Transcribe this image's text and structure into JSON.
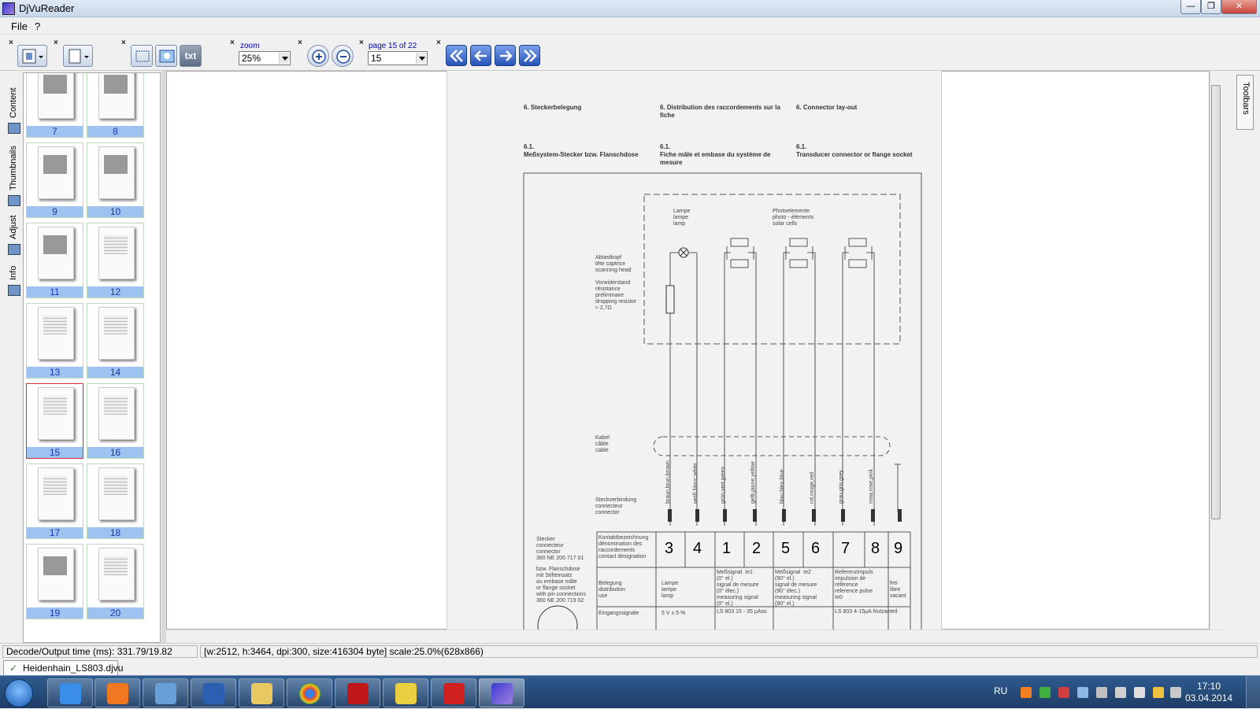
{
  "window": {
    "title": "DjVuReader",
    "min": "—",
    "max": "❐",
    "close": "✕"
  },
  "menu": [
    "File",
    "?"
  ],
  "toolbar": {
    "zoom_label": "zoom",
    "zoom_value": "25%",
    "page_label": "page 15 of 22",
    "page_value": "15",
    "txt_label": "txt"
  },
  "sidebar": {
    "tabs": [
      "Content",
      "Thumbnails",
      "Adjust",
      "Info"
    ],
    "thumbnails": [
      "7",
      "8",
      "9",
      "10",
      "11",
      "12",
      "13",
      "14",
      "15",
      "16",
      "17",
      "18",
      "19",
      "20"
    ],
    "selected": "15"
  },
  "document": {
    "heading_de": "6.  Steckerbelegung",
    "heading_fr": "6.  Distribution des raccordements sur la fiche",
    "heading_en": "6.  Connector lay-out",
    "sub_de_num": "6.1.",
    "sub_de": "Meßsystem-Stecker bzw. Flanschdose",
    "sub_fr_num": "6.1.",
    "sub_fr": "Fiche mâle et embase du système de mesure",
    "sub_en_num": "6.1.",
    "sub_en": "Transducer connector or flange socket",
    "lamp": "Lampe\nlampe\nlamp",
    "photo": "Photoelemente\nphoto - éléments\nsolar cells",
    "scanning": "Abtastkopf\ntête captrice\nscanning head",
    "resistor": "Vorwiderstand\nrésistance\npréliminaire\ndropping resistor\n≈ 2,7Ω",
    "cable": "Kabel\ncâble\ncable",
    "connector": "Steckverbindung\nconnecteur\nconnector",
    "plug": "Stecker\nconnecteur\nconnector\n360 NE 200 717 01",
    "flange": "bzw. Flanschdose\nmit Stifteinsatz\nou embase mâle\nor flange socket\nwith pin connections\n360 NE 200 719 02",
    "contact_header": "Kontaktbezeichnung\ndénomination des\nraccordements\ncontact designation",
    "pins": [
      "3",
      "4",
      "1",
      "2",
      "5",
      "6",
      "7",
      "8",
      "9"
    ],
    "wire_labels": [
      "braun,brun,brown",
      "weiß,blanc,white",
      "grün,vert,green",
      "gelb,jaune,yellow",
      "blau,bleu,blue",
      "rot,rouge,red",
      "grau,gris,grey",
      "rosa,rose,pink"
    ],
    "use_header": "Belegung\ndistribution\nuse",
    "use_lamp": "Lampe\nlampe\nlamp",
    "use_sig1": "Meßsignal  Ie1\n(0° el.)\nsignal de mesure\n(0° élec.)\nmeasuring signal\n(0° el.)",
    "use_sig2": "Meßsignal  Ie2\n(90° el.)\nsignal de mesure\n(90° élec.)\nmeasuring signal\n(90° el.)",
    "use_ref": "Referenzimpuls\nimpulsion de\nréférence\nreference pulse\nIe0",
    "use_free": "frei\nlibre\nvacant",
    "input_header": "Eingangssignale",
    "input_lamp": "5 V ± 5 %",
    "input_sig": "LS 803     15 - 35 µAss",
    "input_ref": "LS 803     4-15µA Nutzanteil"
  },
  "right_panel": {
    "toolbars_label": "Toolbars"
  },
  "status": {
    "decode": "Decode/Output time (ms): 331.79/19.82",
    "info": "[w:2512, h:3464, dpi:300, size:416304 byte] scale:25.0%(628x866)"
  },
  "doc_tab": {
    "filename": "Heidenhain_LS803.djvu"
  },
  "taskbar": {
    "lang": "RU",
    "time": "17:10",
    "date": "03.04.2014"
  }
}
